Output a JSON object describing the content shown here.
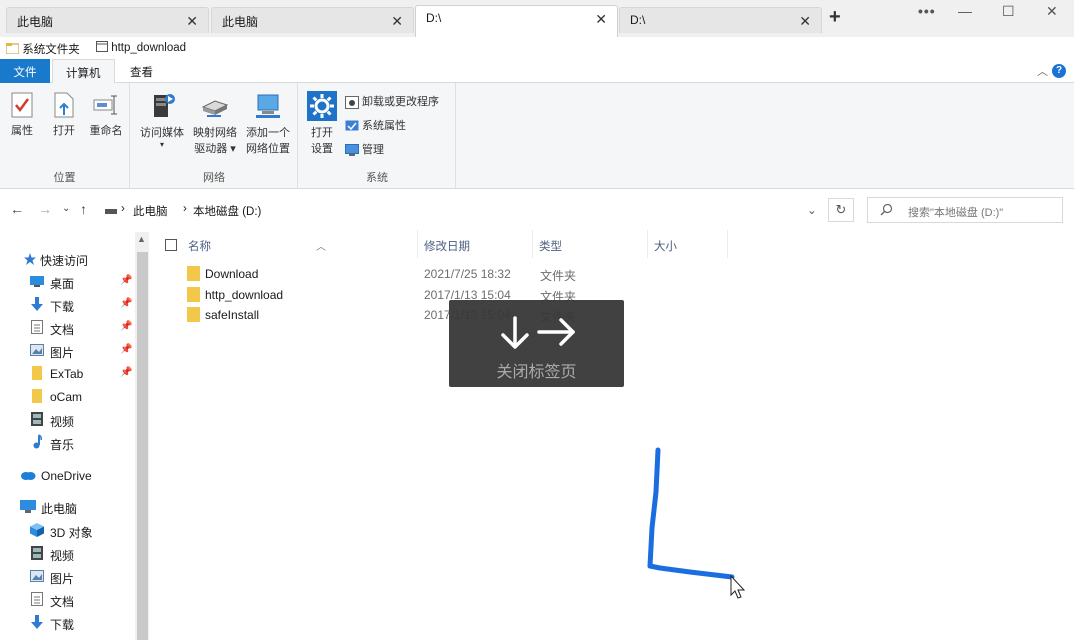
{
  "tabs": [
    {
      "label": "此电脑",
      "active": false
    },
    {
      "label": "此电脑",
      "active": false
    },
    {
      "label": "D:\\",
      "active": true
    },
    {
      "label": "D:\\",
      "active": false
    }
  ],
  "window": {
    "more": "•••",
    "minimize": "—",
    "maximize": "☐",
    "close": "✕"
  },
  "quick_access": [
    {
      "label": "系统文件夹",
      "icon": "folder-icon"
    },
    {
      "label": "http_download",
      "icon": "window-icon"
    }
  ],
  "ribbon_tabs": {
    "file": "文件",
    "computer": "计算机",
    "view": "查看"
  },
  "ribbon": {
    "location": {
      "label": "位置",
      "properties": "属性",
      "open": "打开",
      "rename": "重命名"
    },
    "network": {
      "label": "网络",
      "access_media": "访问媒体",
      "map_drive_1": "映射网络",
      "map_drive_2": "驱动器 ▾",
      "add_location_1": "添加一个",
      "add_location_2": "网络位置"
    },
    "system": {
      "label": "系统",
      "open_settings_1": "打开",
      "open_settings_2": "设置",
      "uninstall": "卸载或更改程序",
      "system_properties": "系统属性",
      "manage": "管理"
    }
  },
  "address": {
    "crumbs": [
      "此电脑",
      "本地磁盘 (D:)"
    ],
    "separator": "›",
    "search_placeholder": "搜索\"本地磁盘 (D:)\""
  },
  "nav": {
    "quick_access": "快速访问",
    "items": [
      {
        "label": "桌面",
        "pinned": true
      },
      {
        "label": "下载",
        "pinned": true
      },
      {
        "label": "文档",
        "pinned": true
      },
      {
        "label": "图片",
        "pinned": true
      },
      {
        "label": "ExTab",
        "pinned": true
      },
      {
        "label": "oCam",
        "pinned": false
      },
      {
        "label": "视频",
        "pinned": false
      },
      {
        "label": "音乐",
        "pinned": false
      }
    ],
    "onedrive": "OneDrive",
    "this_pc": "此电脑",
    "pc_items": [
      "3D 对象",
      "视频",
      "图片",
      "文档",
      "下载"
    ]
  },
  "columns": {
    "name": "名称",
    "date": "修改日期",
    "type": "类型",
    "size": "大小"
  },
  "files": [
    {
      "name": "Download",
      "date": "2021/7/25 18:32",
      "type": "文件夹"
    },
    {
      "name": "http_download",
      "date": "2017/1/13 15:04",
      "type": "文件夹"
    },
    {
      "name": "safeInstall",
      "date": "2017/1/13 15:04",
      "type": "文件夹"
    }
  ],
  "gesture_overlay": {
    "label": "关闭标签页"
  },
  "colors": {
    "accent": "#1979ca",
    "folder": "#f2c84b",
    "stroke": "#1a6ee0"
  }
}
